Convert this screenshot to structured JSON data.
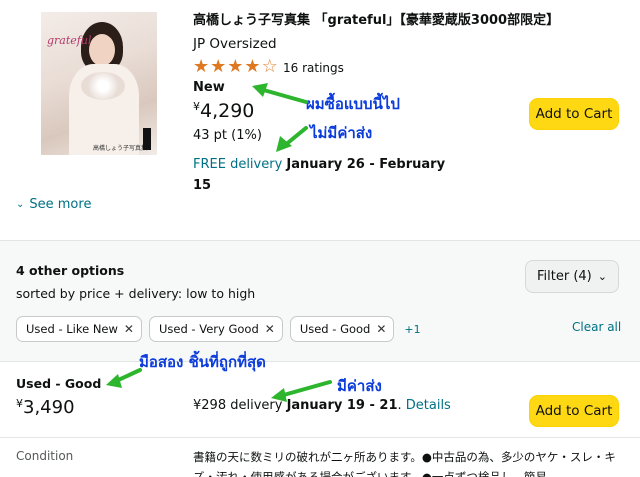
{
  "product": {
    "title": "高橋しょう子写真集 「grateful」【豪華愛蔵版3000部限定】",
    "format": "JP Oversized",
    "rating_value": 4,
    "rating_max": 5,
    "ratings_count": "16 ratings",
    "condition": "New",
    "currency": "¥",
    "price": "4,290",
    "points": "43 pt (1%)",
    "delivery_free": "FREE delivery",
    "delivery_dates": "January 26 - February 15",
    "add_to_cart": "Add to Cart",
    "see_more": "See more",
    "cover_text": "grateful",
    "cover_caption": "高橋しょう子写真集"
  },
  "options": {
    "title": "4 other options",
    "sort": "sorted by price + delivery: low to high",
    "filter_label": "Filter (4)",
    "chips": [
      "Used - Like New",
      "Used - Very Good",
      "Used - Good"
    ],
    "more_count": "+1",
    "clear_all": "Clear all"
  },
  "offer": {
    "condition": "Used - Good",
    "currency": "¥",
    "price": "3,490",
    "delivery_fee": "¥298 delivery",
    "delivery_dates": "January 19 - 21",
    "details": "Details",
    "add_to_cart": "Add to Cart",
    "condition_label": "Condition",
    "condition_desc": "書籍の天に数ミリの破れが二ヶ所あります。●中古品の為、多少のヤケ・スレ・キズ・汚れ・使用感がある場合がございます。●一点ずつ検品し、簡易"
  },
  "annotations": {
    "new_note": "ผมซื้อแบบนี้ไป",
    "no_shipping": "ไม่มีค่าส่ง",
    "cheapest_used": "มือสอง ชิ้นที่ถูกที่สุด",
    "has_shipping": "มีค่าส่ง",
    "color": "#0b3bdb",
    "arrow_color": "#2db52d"
  },
  "colors": {
    "link": "#007185",
    "cart_button": "#ffd814",
    "star": "#de7921",
    "band_bg": "#f7f8f8"
  }
}
